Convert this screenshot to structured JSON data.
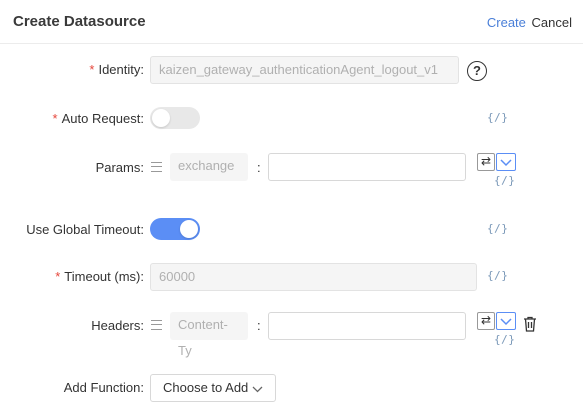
{
  "header": {
    "title": "Create Datasource",
    "create_label": "Create",
    "cancel_label": "Cancel"
  },
  "form": {
    "identity": {
      "label": "Identity",
      "required": "*",
      "value": "kaizen_gateway_authenticationAgent_logout_v1",
      "help": "?"
    },
    "auto_request": {
      "label": "Auto Request",
      "required": "*",
      "enabled": false,
      "code": "{/}"
    },
    "params": {
      "label": "Params",
      "key": "exchange",
      "value": "",
      "code": "{/}"
    },
    "global_timeout": {
      "label": "Use Global Timeout",
      "enabled": true,
      "code": "{/}"
    },
    "timeout": {
      "label": "Timeout (ms)",
      "required": "*",
      "value": "60000",
      "code": "{/}"
    },
    "headers": {
      "label": "Headers",
      "key": "Content-Ty",
      "value": "",
      "code": "{/}"
    },
    "add_function": {
      "label": "Add Function",
      "select": "Choose to Add"
    }
  },
  "icons": {
    "swap": "⇄",
    "colon": ":"
  },
  "colors": {
    "accent": "#5b8ef5",
    "link": "#4a7fd8",
    "required": "#e6453a"
  }
}
